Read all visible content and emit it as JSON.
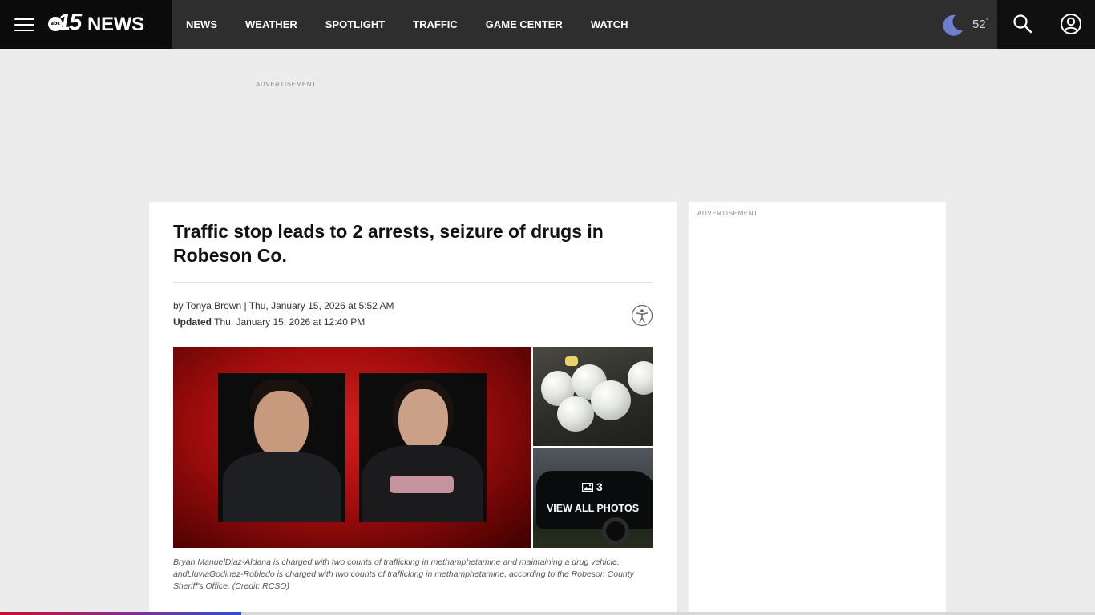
{
  "brand": {
    "logo_badge": "abc",
    "logo_number": "15",
    "logo_word": "NEWS"
  },
  "nav": {
    "items": [
      "NEWS",
      "WEATHER",
      "SPOTLIGHT",
      "TRAFFIC",
      "GAME CENTER",
      "WATCH"
    ]
  },
  "weather": {
    "icon": "moon-icon",
    "temperature": "52",
    "degree_symbol": "°"
  },
  "ads": {
    "top_label": "ADVERTISEMENT",
    "sidebar_label": "ADVERTISEMENT"
  },
  "article": {
    "headline": "Traffic stop leads to 2 arrests, seizure of drugs in Robeson Co.",
    "byline": "by Tonya Brown | Thu, January 15, 2026 at 5:52 AM",
    "updated_label": "Updated",
    "updated_value": " Thu, January 15, 2026 at 12:40 PM",
    "gallery": {
      "photo_count": "3",
      "view_all_label": "VIEW ALL PHOTOS"
    },
    "caption": "Bryan ManuelDiaz-Aldana is charged with two counts of trafficking in methamphetamine and maintaining a drug vehicle, andLluviaGodinez-Robledo is charged with two counts of trafficking in methamphetamine, according to the Robeson County Sheriff's Office. (Credit: RCSO)"
  },
  "reading_progress": {
    "fraction": 0.22
  },
  "colors": {
    "header_bg": "#2e2e2e",
    "brand_bg": "#0b0b0b",
    "tools_bg": "#101010",
    "page_bg": "#ececec",
    "moon": "#6f7fcf"
  }
}
